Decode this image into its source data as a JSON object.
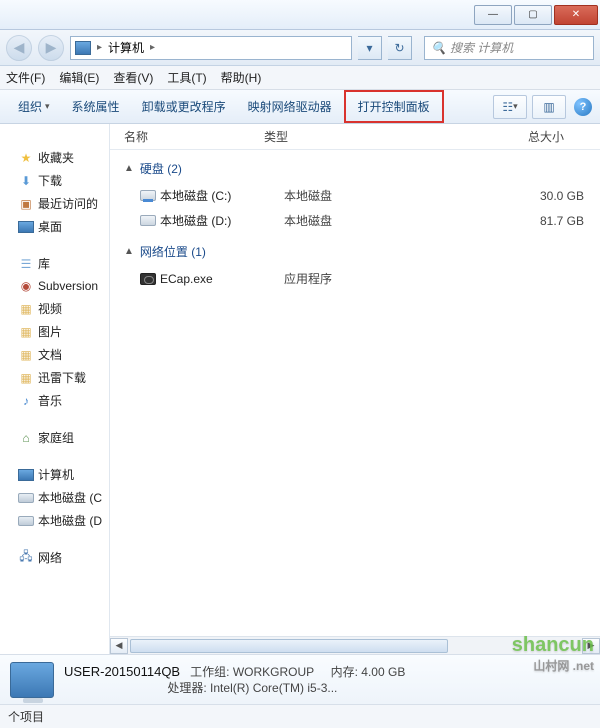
{
  "titlebar": {
    "min": "—",
    "max": "▢",
    "close": "✕"
  },
  "nav": {
    "back": "◀",
    "fwd": "▶",
    "location_icon": "pc",
    "location": "计算机",
    "sep": "▸",
    "drop": "▾",
    "refresh": "↻",
    "search_placeholder": "搜索 计算机",
    "search_icon": "🔍"
  },
  "menu": {
    "file": "文件(F)",
    "edit": "编辑(E)",
    "view": "查看(V)",
    "tools": "工具(T)",
    "help": "帮助(H)"
  },
  "toolbar": {
    "organize": "组织",
    "drop": "▾",
    "sysprops": "系统属性",
    "uninstall": "卸载或更改程序",
    "mapdrive": "映射网络驱动器",
    "control_panel": "打开控制面板",
    "view_icon": "☷",
    "preview_icon": "▥",
    "help": "?"
  },
  "columns": {
    "name": "名称",
    "type": "类型",
    "size": "总大小"
  },
  "sidebar": {
    "favorites": {
      "label": "收藏夹",
      "items": [
        {
          "icon": "dl",
          "label": "下载"
        },
        {
          "icon": "recent",
          "label": "最近访问的"
        },
        {
          "icon": "desk",
          "label": "桌面"
        }
      ]
    },
    "libraries": {
      "label": "库",
      "items": [
        {
          "icon": "svn",
          "label": "Subversion"
        },
        {
          "icon": "folder",
          "label": "视频"
        },
        {
          "icon": "folder",
          "label": "图片"
        },
        {
          "icon": "folder",
          "label": "文档"
        },
        {
          "icon": "folder",
          "label": "迅雷下载"
        },
        {
          "icon": "music",
          "label": "音乐"
        }
      ]
    },
    "homegroup": {
      "label": "家庭组"
    },
    "computer": {
      "label": "计算机",
      "items": [
        {
          "icon": "drive",
          "label": "本地磁盘 (C"
        },
        {
          "icon": "drive",
          "label": "本地磁盘 (D"
        }
      ]
    },
    "network": {
      "label": "网络"
    }
  },
  "content": {
    "groups": [
      {
        "title": "硬盘 (2)",
        "rows": [
          {
            "icon": "drive-c",
            "name": "本地磁盘 (C:)",
            "type": "本地磁盘",
            "size": "30.0 GB"
          },
          {
            "icon": "drive",
            "name": "本地磁盘 (D:)",
            "type": "本地磁盘",
            "size": "81.7 GB"
          }
        ]
      },
      {
        "title": "网络位置 (1)",
        "rows": [
          {
            "icon": "app",
            "name": "ECap.exe",
            "type": "应用程序",
            "size": ""
          }
        ]
      }
    ]
  },
  "details": {
    "computer_name": "USER-20150114QB",
    "workgroup_label": "工作组:",
    "workgroup": "WORKGROUP",
    "memory_label": "内存:",
    "memory": "4.00 GB",
    "cpu_label": "处理器:",
    "cpu": "Intel(R) Core(TM) i5-3..."
  },
  "status": {
    "items": "个项目"
  },
  "watermark": {
    "main": "shancun",
    "sub": "山村网 .net"
  }
}
